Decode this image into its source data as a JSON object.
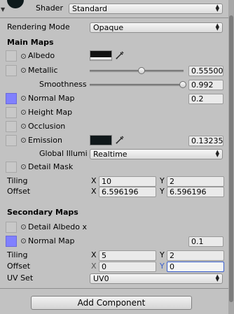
{
  "header": {
    "shader_label": "Shader",
    "shader_value": "Standard"
  },
  "rendering_mode": {
    "label": "Rendering Mode",
    "value": "Opaque"
  },
  "main_maps": {
    "title": "Main Maps",
    "albedo_label": "Albedo",
    "albedo_color": "#111111",
    "metallic_label": "Metallic",
    "metallic_value": "0.55500",
    "metallic_fraction": 0.555,
    "smoothness_label": "Smoothness",
    "smoothness_value": "0.992",
    "smoothness_fraction": 0.992,
    "normal_label": "Normal Map",
    "normal_value": "0.2",
    "height_label": "Height Map",
    "occlusion_label": "Occlusion",
    "emission_label": "Emission",
    "emission_color": "#10181a",
    "emission_value": "0.13235",
    "global_illum_label": "Global Illumi",
    "global_illum_value": "Realtime",
    "detail_mask_label": "Detail Mask",
    "tiling_label": "Tiling",
    "tiling_x": "10",
    "tiling_y": "2",
    "offset_label": "Offset",
    "offset_x": "6.596196",
    "offset_y": "6.596196"
  },
  "secondary_maps": {
    "title": "Secondary Maps",
    "detail_albedo_label": "Detail Albedo x",
    "normal_label": "Normal Map",
    "normal_value": "0.1",
    "tiling_label": "Tiling",
    "tiling_x": "5",
    "tiling_y": "2",
    "offset_label": "Offset",
    "offset_x": "0",
    "offset_y": "0",
    "uv_label": "UV Set",
    "uv_value": "UV0"
  },
  "axes": {
    "x": "X",
    "y": "Y"
  },
  "add_component_label": "Add Component"
}
